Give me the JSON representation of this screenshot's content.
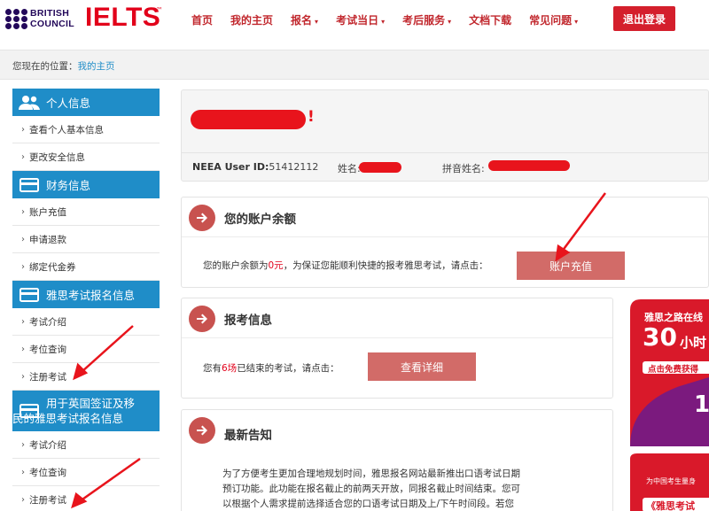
{
  "header": {
    "bc_logo_line1": "BRITISH",
    "bc_logo_line2": "COUNCIL",
    "ielts_logo": "IELTS",
    "trademark": "™",
    "nav": [
      {
        "label": "首页"
      },
      {
        "label": "我的主页"
      },
      {
        "label": "报名",
        "caret": "▾"
      },
      {
        "label": "考试当日",
        "caret": "▾"
      },
      {
        "label": "考后服务",
        "caret": "▾"
      },
      {
        "label": "文档下载"
      },
      {
        "label": "常见问题",
        "caret": "▾"
      }
    ],
    "logout_label": "退出登录"
  },
  "breadcrumb": {
    "prefix": "您现在的位置：",
    "current": "我的主页"
  },
  "sidebar": {
    "sections": [
      {
        "title": "个人信息",
        "icon": "users-icon",
        "items": [
          "查看个人基本信息",
          "更改安全信息"
        ]
      },
      {
        "title": "财务信息",
        "icon": "card-icon",
        "items": [
          "账户充值",
          "申请退款",
          "绑定代金券"
        ]
      },
      {
        "title": "雅思考试报名信息",
        "icon": "card-icon",
        "items": [
          "考试介绍",
          "考位查询",
          "注册考试"
        ]
      },
      {
        "title_line1": "用于英国签证及移",
        "title_line2": "民的雅思考试报名信息",
        "icon": "card-icon",
        "items": [
          "考试介绍",
          "考位查询",
          "注册考试"
        ]
      }
    ]
  },
  "welcome": {
    "exclamation": "!",
    "neea_label": "NEEA User ID:",
    "neea_id": "51412112",
    "name_label": "姓名:",
    "pinyin_label": "拼音姓名:"
  },
  "balance": {
    "title": "您的账户余额",
    "text_before": "您的账户余额为",
    "amount": "0元",
    "text_after": "，为保证您能顺利快捷的报考雅思考试，请点击：",
    "button": "账户充值"
  },
  "registration": {
    "title": "报考信息",
    "text_before": "您有",
    "count": "6场",
    "text_after": "已结束的考试，请点击：",
    "button": "查看详细"
  },
  "notice": {
    "title": "最新告知",
    "lines": [
      "为了方便考生更加合理地规划时间，雅思报名网站最新推出口语考试日期",
      "预订功能。此功能在报名截止的前两天开放，同报名截止时间结束。您可",
      "以根据个人需求提前选择适合您的口语考试日期及上/下午时间段。若您"
    ]
  },
  "ad": {
    "line1": "雅思之路在线",
    "big_num": "30",
    "line2": "小时",
    "cta": "点击免费获得",
    "num": "1",
    "bottom1": "为中国考生量身",
    "bottom2": "《雅思考试"
  },
  "colors": {
    "brand_red": "#e2001a",
    "sidebar_blue": "#1f8dc8",
    "button_red": "#d26b68",
    "circle_red": "#c8524f"
  }
}
